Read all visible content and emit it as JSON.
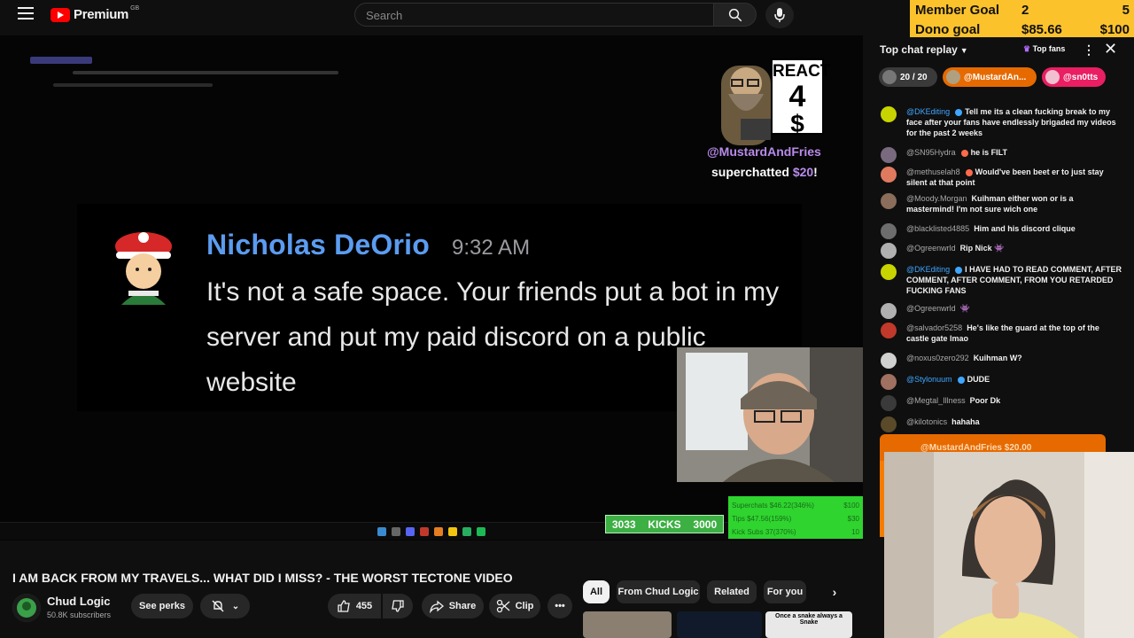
{
  "header": {
    "brand": "Premium",
    "region": "GB",
    "search_placeholder": "Search"
  },
  "goals": [
    {
      "label": "Member Goal",
      "current": "2",
      "target": "5"
    },
    {
      "label": "Dono goal",
      "current": "$85.66",
      "target": "$100"
    }
  ],
  "screen": {
    "message": {
      "author": "Nicholas DeOrio",
      "time": "9:32 AM",
      "body": "It's not a safe space. Your friends put a bot in my server and put my paid discord on a public website"
    },
    "react": {
      "tag_line1": "REACT",
      "tag_line2": "4",
      "tag_line3": "$",
      "user": "@MustardAndFries",
      "superchat_prefix": "superchatted ",
      "superchat_amount": "$20",
      "superchat_suffix": "!"
    },
    "kicks": {
      "left": "3033",
      "label": "KICKS",
      "right": "3000"
    },
    "stats": [
      {
        "label": "Superchats",
        "value": "$46.22(346%)",
        "goal": "$100"
      },
      {
        "label": "Tips",
        "value": "$47.56(159%)",
        "goal": "$30"
      },
      {
        "label": "Kick Subs",
        "value": "37(370%)",
        "goal": "10"
      }
    ]
  },
  "video": {
    "title": "I AM BACK FROM MY TRAVELS... WHAT DID I MISS? - THE WORST TECTONE VIDEO",
    "channel": "Chud Logic",
    "subscribers": "50.8K subscribers",
    "see_perks": "See perks",
    "likes": "455",
    "share": "Share",
    "clip": "Clip"
  },
  "related": {
    "chips": [
      "All",
      "From Chud Logic",
      "Related",
      "For you"
    ],
    "thumb_text": "Once a snake always a Snake"
  },
  "chat": {
    "title": "Top chat replay",
    "top_fans": "Top fans",
    "tickers": [
      {
        "label": "20 / 20",
        "color": "#3a3a3a"
      },
      {
        "label": "@MustardAn...",
        "color": "#e66a00"
      },
      {
        "label": "@sn0tts",
        "color": "#e91e63"
      }
    ],
    "messages": [
      {
        "user": "@DKEditing",
        "badge": "verified",
        "text": "Tell me its a clean fucking break to my face after your fans have endlessly brigaded my videos for the past 2 weeks",
        "avatar": "#c8d400"
      },
      {
        "user": "@SN95Hydra",
        "badge": "mod",
        "text": "he is FILT",
        "avatar": "#7a6a80"
      },
      {
        "user": "@methuselah8",
        "badge": "mod",
        "text": "Would've been beet er to just stay silent at that point",
        "avatar": "#e07a5f"
      },
      {
        "user": "@Moody.Morgan",
        "badge": "",
        "text": "Kuihman either won or is a mastermind! I'm not sure wich one",
        "avatar": "#8a6d5a"
      },
      {
        "user": "@blacklisted4885",
        "badge": "",
        "text": "Him and his discord clique",
        "avatar": "#6d6d6d"
      },
      {
        "user": "@Ogreenwrld",
        "badge": "",
        "text": "Rip Nick 👾",
        "avatar": "#b0b0b0"
      },
      {
        "user": "@DKEditing",
        "badge": "verified",
        "text": "I HAVE HAD TO READ COMMENT, AFTER COMMENT, AFTER COMMENT, FROM YOU RETARDED FUCKING FANS",
        "avatar": "#c8d400"
      },
      {
        "user": "@Ogreenwrld",
        "badge": "",
        "text": "👾",
        "avatar": "#b0b0b0"
      },
      {
        "user": "@salvador5258",
        "badge": "",
        "text": "He's like the guard at the top of the castle gate lmao",
        "avatar": "#c0392b"
      },
      {
        "user": "@noxus0zero292",
        "badge": "",
        "text": "Kuihman W?",
        "avatar": "#d0d0d0"
      },
      {
        "user": "@Stylonuum",
        "badge": "verified",
        "text": "DUDE",
        "avatar": "#a07060"
      },
      {
        "user": "@Megtal_Illness",
        "badge": "",
        "text": "Poor Dk",
        "avatar": "#3a3a3a"
      },
      {
        "user": "@kilotonics",
        "badge": "",
        "text": "hahaha",
        "avatar": "#5a4a2a"
      }
    ],
    "superchat_card": {
      "user": "@MustardAndFries",
      "amount": "$20.00"
    }
  }
}
